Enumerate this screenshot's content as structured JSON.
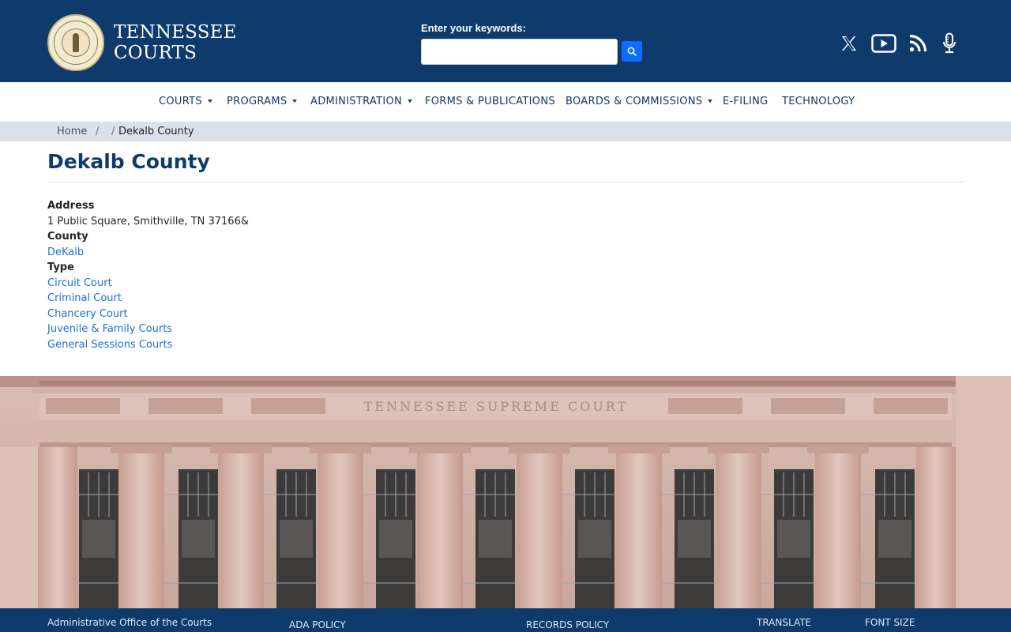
{
  "header": {
    "brand_line1": "TENNESSEE",
    "brand_line2": "COURTS",
    "search_label": "Enter your keywords:",
    "search_value": "",
    "icons": [
      "search-icon",
      "x-twitter-icon",
      "youtube-icon",
      "rss-icon",
      "podcast-microphone-icon"
    ],
    "colors": {
      "header_bg": "#0e3b6c",
      "accent": "#0d6efd",
      "link": "#1f6fd0"
    }
  },
  "nav": {
    "items": [
      {
        "label": "COURTS",
        "dropdown": true
      },
      {
        "label": "PROGRAMS",
        "dropdown": true
      },
      {
        "label": "ADMINISTRATION",
        "dropdown": true
      },
      {
        "label": "FORMS & PUBLICATIONS",
        "dropdown": false
      },
      {
        "label": "BOARDS & COMMISSIONS",
        "dropdown": true
      },
      {
        "label": "E-FILING",
        "dropdown": false
      },
      {
        "label": "TECHNOLOGY",
        "dropdown": false
      }
    ]
  },
  "breadcrumb": {
    "home": "Home",
    "separator": "/",
    "current": "Dekalb County"
  },
  "main": {
    "title": "Dekalb County",
    "address_label": "Address",
    "address_value": "1 Public Square, Smithville, TN 37166&",
    "county_label": "County",
    "county_value": "DeKalb",
    "type_label": "Type",
    "types": [
      "Circuit Court",
      "Criminal Court",
      "Chancery Court",
      "Juvenile & Family Courts",
      "General Sessions Courts"
    ]
  },
  "photo": {
    "inscription": "TENNESSEE SUPREME COURT"
  },
  "footer": {
    "aoc": "Administrative Office of the Courts",
    "ada": "ADA POLICY",
    "records": "RECORDS POLICY",
    "translate": "TRANSLATE",
    "font_size": "FONT SIZE"
  }
}
